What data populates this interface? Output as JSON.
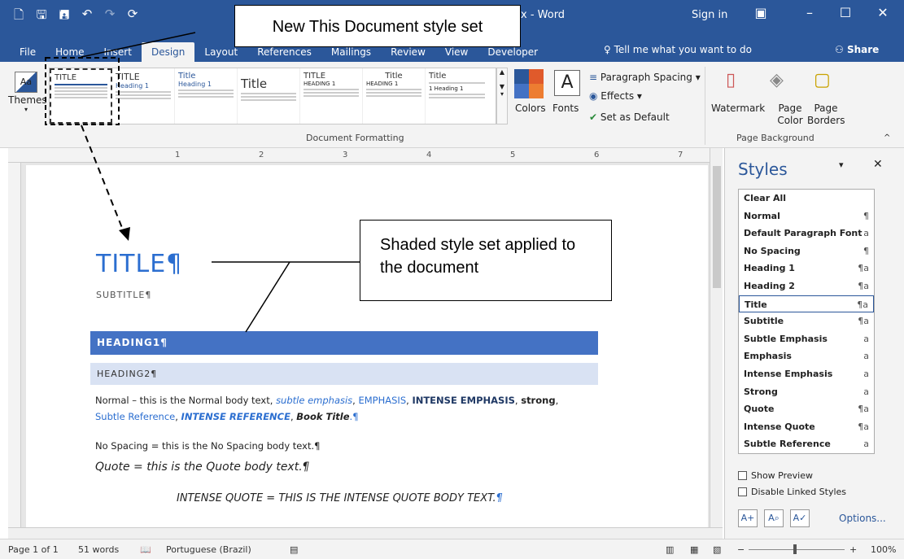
{
  "window": {
    "title": "x - Word",
    "sign_in": "Sign in",
    "controls": [
      "–",
      "☐",
      "✕"
    ],
    "qat_icons": [
      "new-doc-icon",
      "save-icon",
      "save-as-icon",
      "undo-icon",
      "redo-icon",
      "repeat-icon",
      "touch-mode-icon"
    ]
  },
  "tabs": [
    {
      "label": "File"
    },
    {
      "label": "Home"
    },
    {
      "label": "Insert"
    },
    {
      "label": "Design",
      "active": true
    },
    {
      "label": "Layout"
    },
    {
      "label": "References"
    },
    {
      "label": "Mailings"
    },
    {
      "label": "Review"
    },
    {
      "label": "View"
    },
    {
      "label": "Developer"
    }
  ],
  "tell_me": "Tell me what you want to do",
  "share": "Share",
  "ribbon": {
    "themes_label": "Themes",
    "gallery": [
      {
        "title": "TITLE",
        "heading": "HEADING 1"
      },
      {
        "title": "TITLE",
        "heading": "Heading 1"
      },
      {
        "title": "Title",
        "heading": "Heading 1"
      },
      {
        "title": "Title",
        "heading": ""
      },
      {
        "title": "TITLE",
        "heading": "HEADING 1"
      },
      {
        "title": "Title",
        "heading": "HEADING 1"
      },
      {
        "title": "Title",
        "heading": "1 Heading 1"
      }
    ],
    "colors_label": "Colors",
    "fonts_label": "Fonts",
    "paragraph_spacing": "Paragraph Spacing",
    "effects": "Effects",
    "set_as_default": "Set as Default",
    "document_formatting": "Document Formatting",
    "watermark": "Watermark",
    "page_color": "Page Color",
    "page_borders": "Page Borders",
    "page_background": "Page Background",
    "theme_colors": [
      "#2b579a",
      "#e05a2b",
      "#4472c4",
      "#ed7d31"
    ]
  },
  "ruler": {
    "ticks": [
      "1",
      "2",
      "3",
      "4",
      "5",
      "6",
      "7"
    ]
  },
  "document": {
    "title": "TITLE¶",
    "subtitle": "SUBTITLE¶",
    "heading1": "HEADING1¶",
    "heading2": "HEADING2¶",
    "normal_prefix": "Normal – this is the Normal body text, ",
    "subtle_emphasis": "subtle emphasis",
    "sep1": ", ",
    "emphasis": "EMPHASIS",
    "sep2": ",  ",
    "intense_emphasis": "INTENSE EMPHASIS",
    "sep3": ", ",
    "strong": "strong",
    "sep4": ",",
    "subtle_reference": "Subtle Reference",
    "sep5": ", ",
    "intense_reference": "INTENSE REFERENCE",
    "sep6": ", ",
    "book_title": "Book Title",
    "end_mark": ".¶",
    "no_spacing": "No Spacing = this is the No Spacing body text.¶",
    "quote": "Quote = this is the Quote body text.¶",
    "intense_quote": "INTENSE QUOTE = THIS IS THE INTENSE QUOTE BODY TEXT.",
    "intense_quote_mark": "¶"
  },
  "callouts": {
    "new_style_set": "New This Document style set",
    "shaded_applied": "Shaded style set applied to the document"
  },
  "styles_pane": {
    "title": "Styles",
    "items": [
      {
        "name": "Clear All",
        "mark": ""
      },
      {
        "name": "Normal",
        "mark": "¶"
      },
      {
        "name": "Default Paragraph Font",
        "mark": "a"
      },
      {
        "name": "No Spacing",
        "mark": "¶"
      },
      {
        "name": "Heading 1",
        "mark": "¶a"
      },
      {
        "name": "Heading 2",
        "mark": "¶a"
      },
      {
        "name": "Title",
        "mark": "¶a",
        "selected": true
      },
      {
        "name": "Subtitle",
        "mark": "¶a"
      },
      {
        "name": "Subtle Emphasis",
        "mark": "a"
      },
      {
        "name": "Emphasis",
        "mark": "a"
      },
      {
        "name": "Intense Emphasis",
        "mark": "a"
      },
      {
        "name": "Strong",
        "mark": "a"
      },
      {
        "name": "Quote",
        "mark": "¶a"
      },
      {
        "name": "Intense Quote",
        "mark": "¶a"
      },
      {
        "name": "Subtle Reference",
        "mark": "a"
      }
    ],
    "show_preview": "Show Preview",
    "disable_linked": "Disable Linked Styles",
    "options": "Options..."
  },
  "status": {
    "page": "Page 1 of 1",
    "words": "51 words",
    "language": "Portuguese (Brazil)",
    "zoom": "100%"
  }
}
